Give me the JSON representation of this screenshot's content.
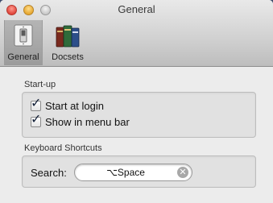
{
  "window": {
    "title": "General"
  },
  "toolbar": {
    "items": [
      {
        "label": "General",
        "icon": "light-switch-icon",
        "selected": true
      },
      {
        "label": "Docsets",
        "icon": "books-icon",
        "selected": false
      }
    ]
  },
  "startup": {
    "title": "Start-up",
    "options": [
      {
        "label": "Start at login",
        "checked": true
      },
      {
        "label": "Show in menu bar",
        "checked": true
      }
    ]
  },
  "shortcuts": {
    "title": "Keyboard Shortcuts",
    "search_label": "Search:",
    "search_value": "⌥Space",
    "clear_symbol": "✕"
  },
  "colors": {
    "desktop": "#3b4a6b",
    "window_bg": "#ececec",
    "close": "#e0463c",
    "minimize": "#e6a731",
    "zoom": "#c8c8c8"
  }
}
